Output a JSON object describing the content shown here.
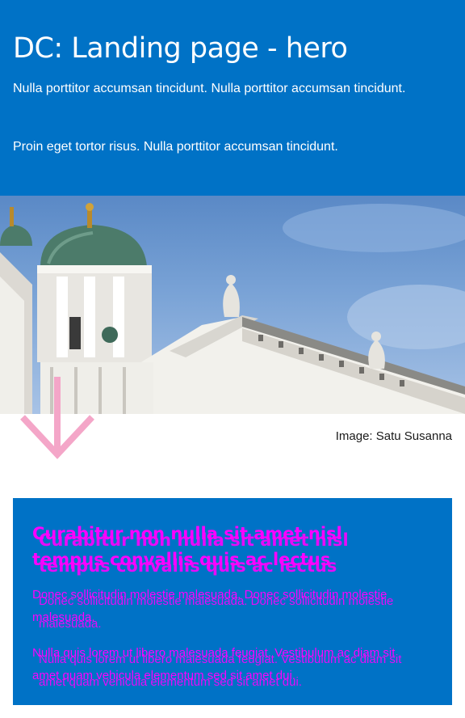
{
  "hero": {
    "title": "DC: Landing page - hero",
    "paragraph_1": "Nulla porttitor accumsan tincidunt. Nulla porttitor accumsan tincidunt.",
    "paragraph_2": "Proin eget tortor risus. Nulla porttitor accumsan tincidunt.",
    "background_color": "#0072c6"
  },
  "image": {
    "caption": "Image: Satu Susanna",
    "subject": "Helsinki Cathedral"
  },
  "scroll_arrow": {
    "icon": "arrow-down-icon",
    "color": "#f4a6c8"
  },
  "card": {
    "heading": "Curabitur non nulla sit amet nisl tempus convallis quis ac lectus",
    "paragraph_1": "Donec sollicitudin molestie malesuada. Donec sollicitudin molestie malesuada.",
    "paragraph_2": "Nulla quis lorem ut libero malesuada feugiat. Vestibulum ac diam sit amet quam vehicula elementum sed sit amet dui.",
    "background_color": "#0072c6",
    "text_color": "#ff00ff"
  }
}
